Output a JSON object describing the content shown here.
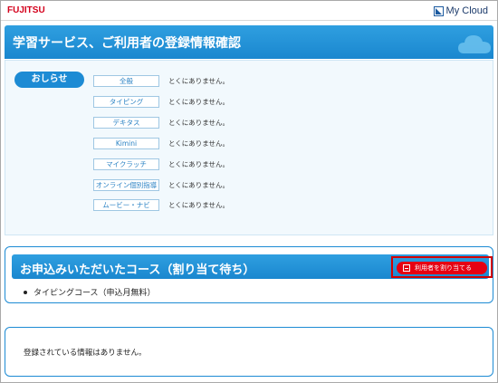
{
  "header": {
    "brand": "FUJITSU",
    "mycloud_label": "My Cloud"
  },
  "page_title": "学習サービス、ご利用者の登録情報確認",
  "notice": {
    "badge": "おしらせ",
    "items": [
      {
        "tag": "全般",
        "text": "とくにありません。"
      },
      {
        "tag": "タイピング",
        "text": "とくにありません。"
      },
      {
        "tag": "デキタス",
        "text": "とくにありません。"
      },
      {
        "tag": "Kimini",
        "text": "とくにありません。"
      },
      {
        "tag": "マイクラッチ",
        "text": "とくにありません。"
      },
      {
        "tag": "オンライン個別指導",
        "text": "とくにありません。"
      },
      {
        "tag": "ムービー・ナビ",
        "text": "とくにありません。"
      }
    ]
  },
  "course": {
    "title": "お申込みいただいたコース（割り当て待ち）",
    "assign_button": "利用者を割り当てる",
    "items": [
      "タイピングコース（申込月無料）"
    ]
  },
  "registered": {
    "message": "登録されている情報はありません。"
  },
  "colors": {
    "brand_red": "#d4001c",
    "accent_blue": "#1d8bd4",
    "button_red": "#e60012",
    "highlight_border": "#d40000"
  }
}
